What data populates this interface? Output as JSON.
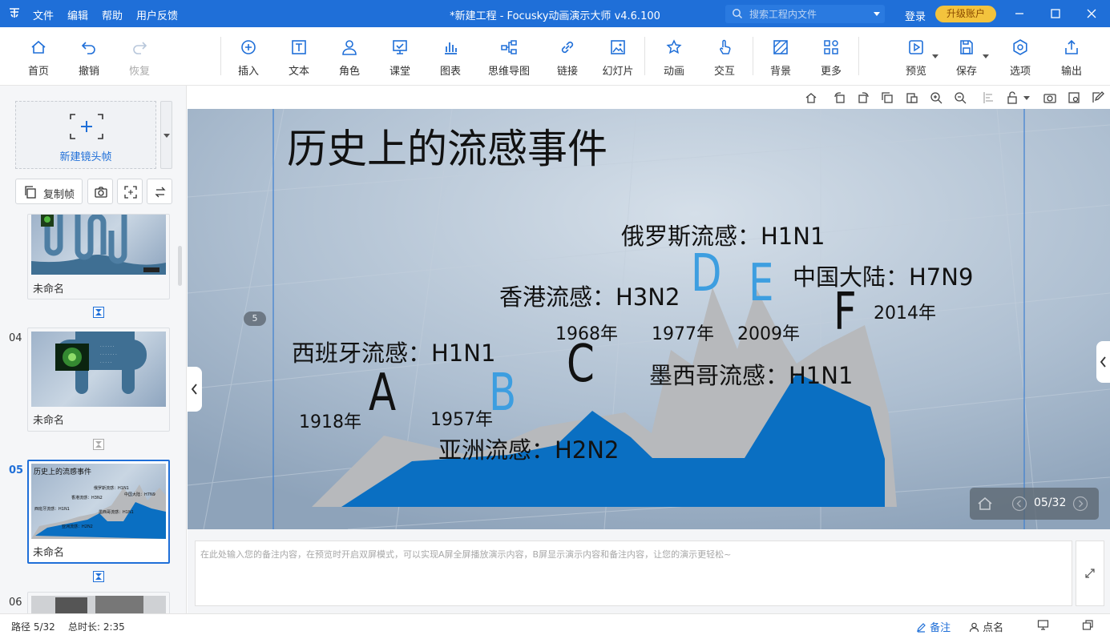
{
  "titlebar": {
    "menus": [
      "文件",
      "编辑",
      "帮助",
      "用户反馈"
    ],
    "title": "*新建工程 - Focusky动画演示大师  v4.6.100",
    "search_placeholder": "搜索工程内文件",
    "login": "登录",
    "upgrade": "升级账户"
  },
  "toolbar": {
    "home": "首页",
    "undo": "撤销",
    "redo": "恢复",
    "insert": "插入",
    "text": "文本",
    "role": "角色",
    "classroom": "课堂",
    "chart": "图表",
    "mindmap": "思维导图",
    "link": "链接",
    "slides": "幻灯片",
    "animation": "动画",
    "interact": "交互",
    "background": "背景",
    "more": "更多",
    "preview": "预览",
    "save": "保存",
    "options": "选项",
    "export": "输出"
  },
  "left_panel": {
    "new_frame": "新建镜头帧",
    "copy_frame": "复制帧",
    "slides": [
      {
        "num": "",
        "name": "未命名"
      },
      {
        "num": "04",
        "name": "未命名"
      },
      {
        "num": "05",
        "name": "未命名"
      },
      {
        "num": "06",
        "name": ""
      }
    ],
    "thumb5": {
      "title": "历史上的流感事件",
      "russia": "俄罗斯流感：H1N1",
      "hk": "香港流感：H3N2",
      "china": "中国大陆：H7N9",
      "spain": "西班牙流感：H1N1",
      "mexico": "墨西哥流感：H1N1",
      "asia": "亚洲流感：H2N2"
    }
  },
  "slide": {
    "title": "历史上的流感事件",
    "events": {
      "russia": "俄罗斯流感：H1N1",
      "china": "中国大陆：H7N9",
      "hongkong": "香港流感：H3N2",
      "spain": "西班牙流感：H1N1",
      "mexico": "墨西哥流感：H1N1",
      "asia": "亚洲流感：H2N2"
    },
    "years": {
      "y1918": "1918年",
      "y1957": "1957年",
      "y1968": "1968年",
      "y1977": "1977年",
      "y2009": "2009年",
      "y2014": "2014年"
    },
    "letters": {
      "a": "A",
      "b": "B",
      "c": "C",
      "d": "D",
      "e": "E",
      "f": "F"
    },
    "badge": "5",
    "page_indicator": "05/32"
  },
  "notes": {
    "placeholder": "在此处输入您的备注内容，在预览时开启双屏模式，可以实现A屏全屏播放演示内容，B屏显示演示内容和备注内容，让您的演示更轻松~"
  },
  "statusbar": {
    "path": "路径 5/32",
    "duration": "总时长: 2:35",
    "notes": "备注",
    "rollcall": "点名"
  },
  "colors": {
    "accent": "#1f6fd8",
    "chart_blue": "#0a6fc2",
    "chart_gray": "#b7b9bc",
    "letter_blue": "#3d9ee0"
  }
}
